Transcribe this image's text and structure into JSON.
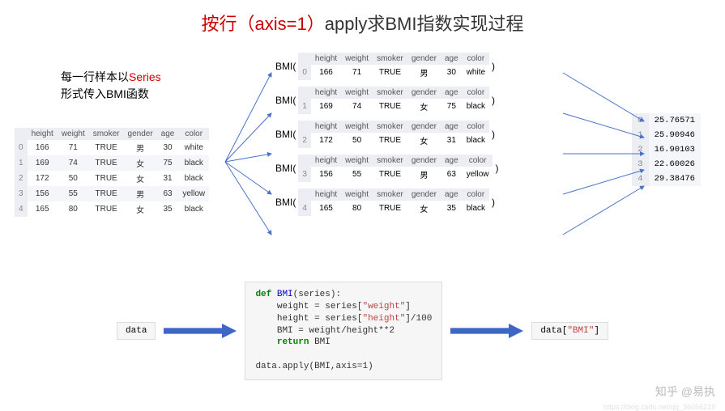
{
  "title": {
    "red_part": "按行（axis=1）",
    "black_part": "apply求BMI指数实现过程"
  },
  "desc": {
    "line1_a": "每一行样本以",
    "line1_b": "Series",
    "line2": "形式传入BMI函数"
  },
  "columns": [
    "height",
    "weight",
    "smoker",
    "gender",
    "age",
    "color"
  ],
  "src_rows": [
    {
      "idx": "0",
      "height": "166",
      "weight": "71",
      "smoker": "TRUE",
      "gender": "男",
      "age": "30",
      "color": "white"
    },
    {
      "idx": "1",
      "height": "169",
      "weight": "74",
      "smoker": "TRUE",
      "gender": "女",
      "age": "75",
      "color": "black"
    },
    {
      "idx": "2",
      "height": "172",
      "weight": "50",
      "smoker": "TRUE",
      "gender": "女",
      "age": "31",
      "color": "black"
    },
    {
      "idx": "3",
      "height": "156",
      "weight": "55",
      "smoker": "TRUE",
      "gender": "男",
      "age": "63",
      "color": "yellow"
    },
    {
      "idx": "4",
      "height": "165",
      "weight": "80",
      "smoker": "TRUE",
      "gender": "女",
      "age": "35",
      "color": "black"
    }
  ],
  "bmi_call_label": "BMI(",
  "bmi_call_close": ")",
  "results": [
    {
      "idx": "0",
      "val": "25.76571"
    },
    {
      "idx": "1",
      "val": "25.90946"
    },
    {
      "idx": "2",
      "val": "16.90103"
    },
    {
      "idx": "3",
      "val": "22.60026"
    },
    {
      "idx": "4",
      "val": "29.38476"
    }
  ],
  "flow": {
    "left_box": "data",
    "right_box_pre": "data[",
    "right_box_str": "\"BMI\"",
    "right_box_post": "]"
  },
  "code": {
    "l1_kw": "def ",
    "l1_fn": "BMI",
    "l1_rest": "(series):",
    "l2a": "    weight = series[",
    "l2s": "\"weight\"",
    "l2b": "]",
    "l3a": "    height = series[",
    "l3s": "\"height\"",
    "l3b": "]/100",
    "l4": "    BMI = weight/height**2",
    "l5_kw": "    return ",
    "l5_rest": "BMI",
    "l6": "",
    "l7": "data.apply(BMI,axis=1)"
  },
  "watermark": "知乎 @易执",
  "watermark2": "https://blog.csdn.net/qq_36056219"
}
